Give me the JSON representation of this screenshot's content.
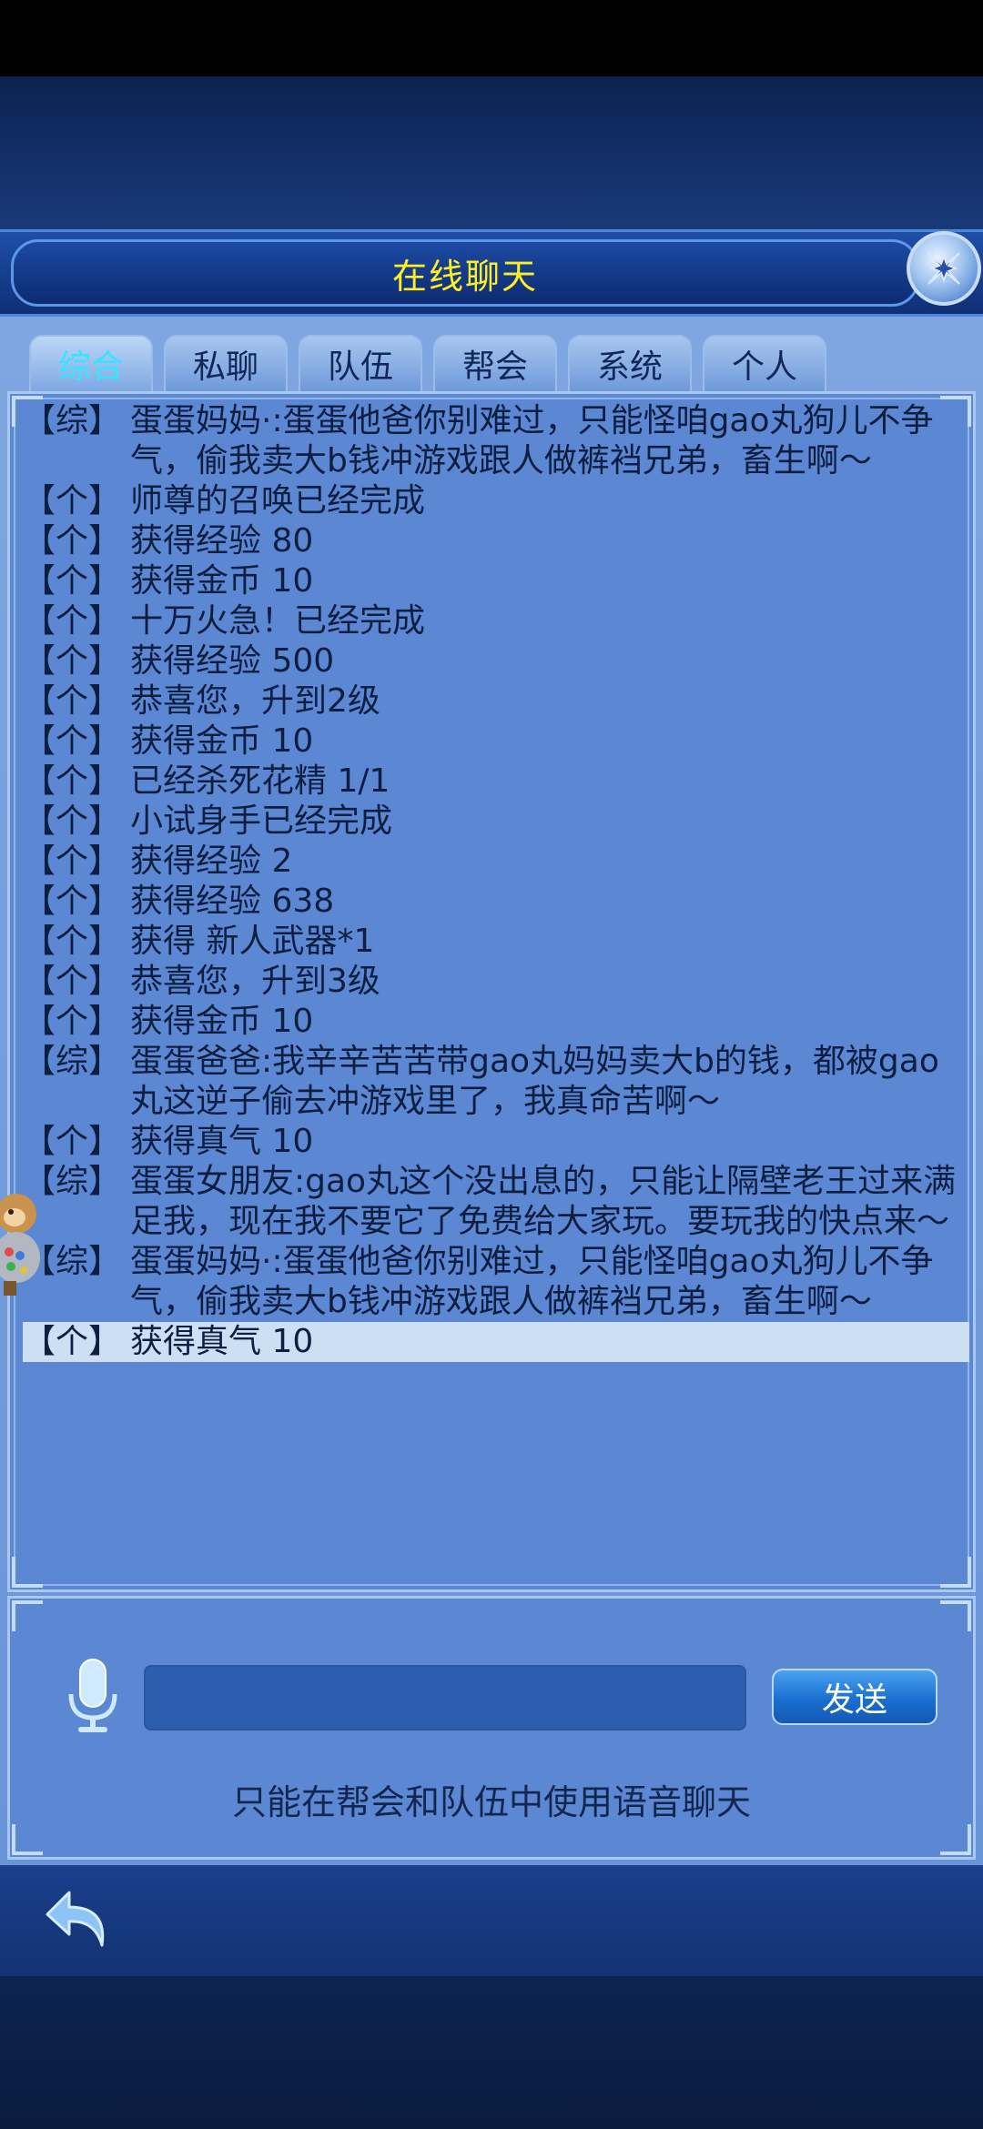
{
  "header": {
    "title": "在线聊天"
  },
  "tabs": [
    {
      "label": "综合",
      "active": true
    },
    {
      "label": "私聊",
      "active": false
    },
    {
      "label": "队伍",
      "active": false
    },
    {
      "label": "帮会",
      "active": false
    },
    {
      "label": "系统",
      "active": false
    },
    {
      "label": "个人",
      "active": false
    }
  ],
  "messages": [
    {
      "channel": "【综】",
      "text": "蛋蛋妈妈·:蛋蛋他爸你别难过，只能怪咱gao丸狗儿不争气，偷我卖大b钱冲游戏跟人做裤裆兄弟，畜生啊～"
    },
    {
      "channel": "【个】",
      "text": "师尊的召唤已经完成"
    },
    {
      "channel": "【个】",
      "text": "获得经验 80"
    },
    {
      "channel": "【个】",
      "text": "获得金币 10"
    },
    {
      "channel": "【个】",
      "text": "十万火急！已经完成"
    },
    {
      "channel": "【个】",
      "text": "获得经验 500"
    },
    {
      "channel": "【个】",
      "text": "恭喜您，升到2级"
    },
    {
      "channel": "【个】",
      "text": "获得金币 10"
    },
    {
      "channel": "【个】",
      "text": "已经杀死花精 1/1"
    },
    {
      "channel": "【个】",
      "text": "小试身手已经完成"
    },
    {
      "channel": "【个】",
      "text": "获得经验 2"
    },
    {
      "channel": "【个】",
      "text": "获得经验 638"
    },
    {
      "channel": "【个】",
      "text": "获得 新人武器*1"
    },
    {
      "channel": "【个】",
      "text": "恭喜您，升到3级"
    },
    {
      "channel": "【个】",
      "text": "获得金币 10"
    },
    {
      "channel": "【综】",
      "text": "蛋蛋爸爸:我辛辛苦苦带gao丸妈妈卖大b的钱，都被gao丸这逆子偷去冲游戏里了，我真命苦啊～"
    },
    {
      "channel": "【个】",
      "text": "获得真气 10"
    },
    {
      "channel": "【综】",
      "text": "蛋蛋女朋友:gao丸这个没出息的，只能让隔壁老王过来满足我，现在我不要它了免费给大家玩。要玩我的快点来～"
    },
    {
      "channel": "【综】",
      "text": "蛋蛋妈妈·:蛋蛋他爸你别难过，只能怪咱gao丸狗儿不争气，偷我卖大b钱冲游戏跟人做裤裆兄弟，畜生啊～"
    },
    {
      "channel": "【个】",
      "text": "获得真气 10",
      "highlighted": true
    }
  ],
  "input": {
    "value": "",
    "placeholder": ""
  },
  "send_button": {
    "label": "发送"
  },
  "voice_note": "只能在帮会和队伍中使用语音聊天",
  "icons": {
    "close": "close-x-icon",
    "mic": "microphone-icon",
    "back": "back-arrow-icon"
  },
  "colors": {
    "title": "#ffee22",
    "active_tab": "#32e6ff",
    "panel": "#5c88d3",
    "highlight_row": "#cddff2"
  }
}
